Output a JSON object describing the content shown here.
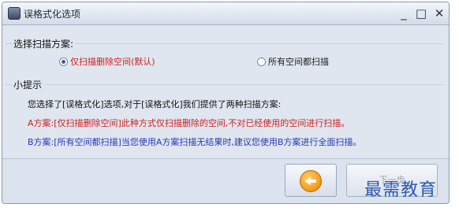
{
  "window": {
    "title": "误格式化选项",
    "controls": {
      "minimize": "_",
      "maximize": "□",
      "close": "✕"
    }
  },
  "scan_plan": {
    "legend": "选择扫描方案:",
    "options": [
      {
        "label": "仅扫描删除空间(默认)",
        "selected": true
      },
      {
        "label": "所有空间都扫描",
        "selected": false
      }
    ]
  },
  "tips": {
    "legend": "小提示",
    "line1": "您选择了[误格式化]选项,对于[误格式化]我们提供了两种扫描方案:",
    "line2": "A方案:[仅扫描删除空间]此种方式仅扫描删除的空间,不对已经使用的空间进行扫描。",
    "line3": "B方案:[所有空间都扫描]当您使用A方案扫描无结果时,建议您使用B方案进行全面扫描。"
  },
  "footer": {
    "back_icon": "back-arrow-icon",
    "next_label": "下一步"
  },
  "watermark": "最需教育",
  "colors": {
    "accent_red": "#d41c1c",
    "accent_blue": "#2436b8",
    "watermark": "#2b59b3"
  }
}
